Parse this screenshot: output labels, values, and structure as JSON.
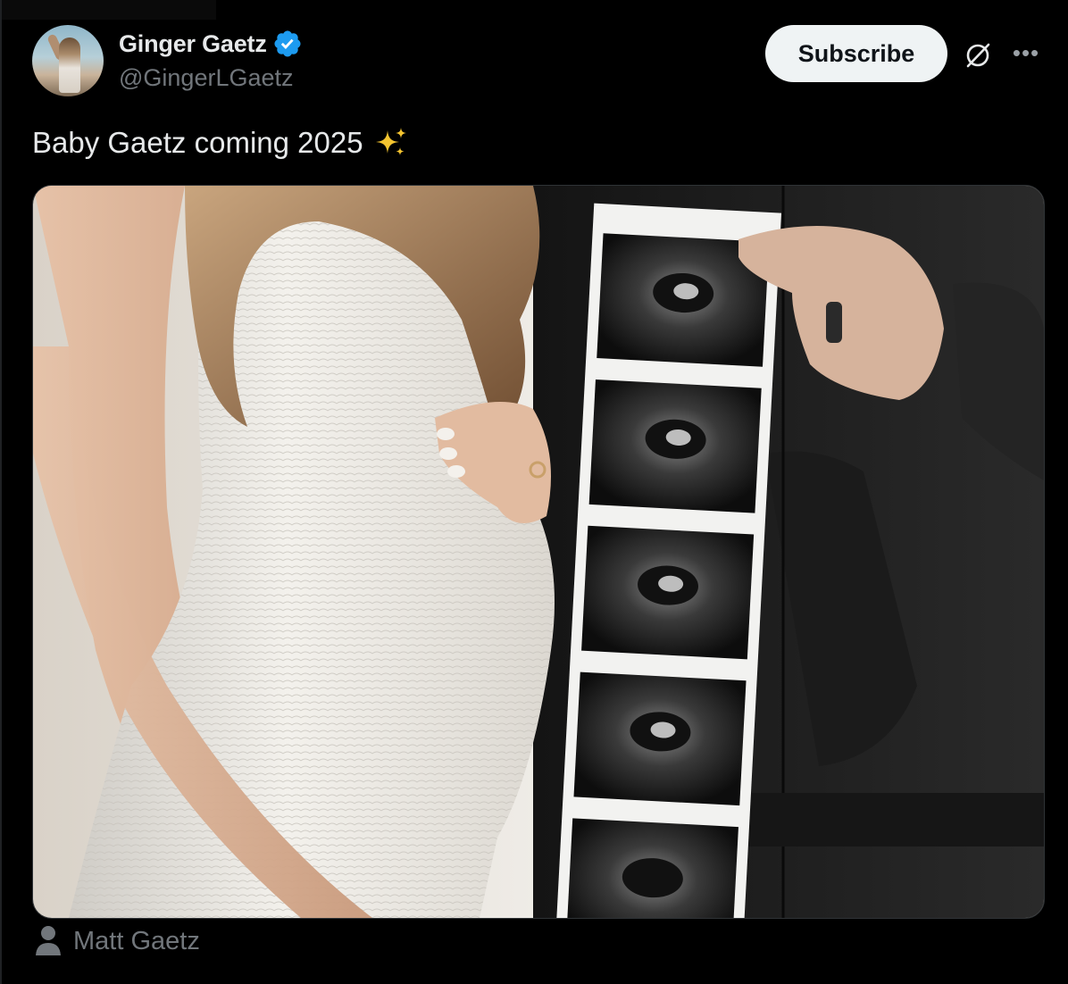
{
  "author": {
    "display_name": "Ginger Gaetz",
    "handle": "@GingerLGaetz",
    "verified": true
  },
  "actions": {
    "subscribe_label": "Subscribe",
    "grok_icon": "grok-icon",
    "more_icon": "more-icon"
  },
  "post": {
    "text": "Baby Gaetz coming 2025",
    "emoji_icon": "sparkles-icon"
  },
  "media": {
    "type": "photo"
  },
  "tagged": {
    "name": "Matt Gaetz",
    "icon": "person-icon"
  },
  "colors": {
    "background": "#000000",
    "text_primary": "#e7e9ea",
    "text_secondary": "#71767b",
    "verified_blue": "#1d9bf0",
    "subscribe_bg": "#eff3f4"
  }
}
